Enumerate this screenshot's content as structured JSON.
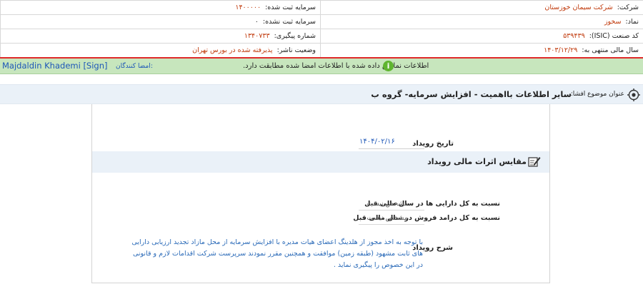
{
  "company_info": {
    "company_label": "شرکت:",
    "company_value": "شرکت سیمان خوزستان",
    "symbol_label": "نماد:",
    "symbol_value": "سخوز",
    "isic_label": "کد صنعت (ISIC):",
    "isic_value": "۵۳۹۴۳۹",
    "fiscal_year_label": "سال مالی منتهی به:",
    "fiscal_year_value": "۱۴۰۳/۱۲/۲۹",
    "registered_capital_label": "سرمایه ثبت شده:",
    "registered_capital_value": "۱۴۰۰۰۰۰",
    "unregistered_capital_label": "سرمایه ثبت نشده:",
    "unregistered_capital_value": "۰",
    "tracking_label": "شماره پیگیری:",
    "tracking_value": "۱۳۴۰۷۳۳",
    "publisher_status_label": "وضعیت ناشر:",
    "publisher_status_value": "پذیرفته شده در بورس تهران"
  },
  "signature": {
    "signer_name": "Majdaldin Khademi [Sign]",
    "signers_label": "امضا کنندگان:",
    "message": "اطلاعات نمایش داده شده با اطلاعات امضا شده مطابقت دارد.",
    "info_icon": "info-icon"
  },
  "subject": {
    "label": "عنوان موضوع افشا:",
    "title": "سایر اطلاعات بااهمیت - افزایش سرمایه- گروه ب",
    "icon": "target-icon"
  },
  "event": {
    "date_label": "تاریخ رویداد",
    "date_value": "۱۴۰۴/۰۲/۱۶"
  },
  "financial_effects": {
    "section_title": "مقایس اثرات مالی رویداد",
    "section_icon": "edit-icon",
    "assets_ratio_label": "نسبت به کل دارایی ها در سال مالی قبل",
    "assets_ratio_value": "مشخص نیست",
    "revenue_ratio_label": "نسبت به کل درامد فروش در سال مالی قبل",
    "revenue_ratio_value": "مشخص نیست"
  },
  "description": {
    "label": "شرح رویداد",
    "text": "با توجه به اخذ مجوز از هلدینگ اعضای هیات مدیره با افزایش سرمایه از محل مازاد تجدید ارزیابی دارایی های ثابت مشهود (طبقه زمین) موافقت و همچنین مقرر نمودند سرپرست شرکت اقدامات لازم و قانونی در این خصوص را پیگیری نماید ."
  },
  "colors": {
    "accent_red": "#e02a2a",
    "value_orange": "#c0390b",
    "signature_green": "#c7e6bd",
    "link_blue": "#1d57b8"
  }
}
